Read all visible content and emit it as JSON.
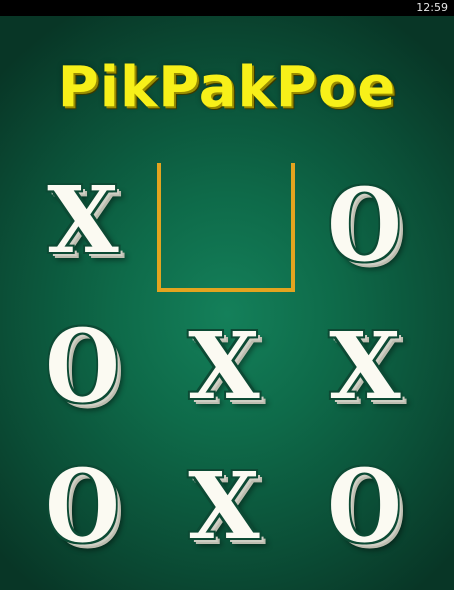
{
  "status_bar": {
    "time": "12:59"
  },
  "game": {
    "title": "PikPakPoe",
    "board": [
      [
        "X",
        "",
        "O"
      ],
      [
        "O",
        "X",
        "X"
      ],
      [
        "O",
        "X",
        "O"
      ]
    ],
    "selected_cell": {
      "row": 0,
      "col": 1
    }
  },
  "colors": {
    "background": "#0e6a49",
    "title": "#f7f019",
    "selection_outline": "#e3a41f",
    "mark_fill": "#fbfaf2"
  }
}
